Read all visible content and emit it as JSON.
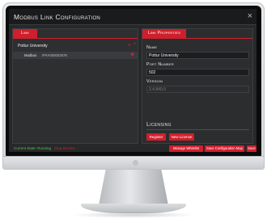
{
  "window": {
    "title": "Modbus Link Configuration",
    "close_glyph": "×"
  },
  "left_panel": {
    "tab_label": "Link",
    "tree": {
      "root_label": "Pottur University",
      "add_glyph": "+",
      "collapse_glyph": "^",
      "child_label": "Modbus",
      "child_value": "IP#A000002578",
      "health_glyph": "♥"
    }
  },
  "right_panel": {
    "tab_label": "Link Properties",
    "fields": {
      "name_label": "Name",
      "name_value": "Pottur University",
      "port_label": "Port Number",
      "port_value": "502",
      "version_label": "Version",
      "version_value": "2.4.840.0"
    },
    "licensing": {
      "heading": "Licensing",
      "register_label": "Register",
      "new_license_label": "New License"
    }
  },
  "footer": {
    "status_text": "Current State: Running",
    "stop_service_label": "Stop Service",
    "manage_whitelist_label": "Manage Whitelist",
    "save_config_map_label": "Save Configuration Map",
    "save_label": "Save"
  },
  "colors": {
    "accent": "#cf1f2d",
    "running": "#4ec84e",
    "background": "#27282a"
  }
}
